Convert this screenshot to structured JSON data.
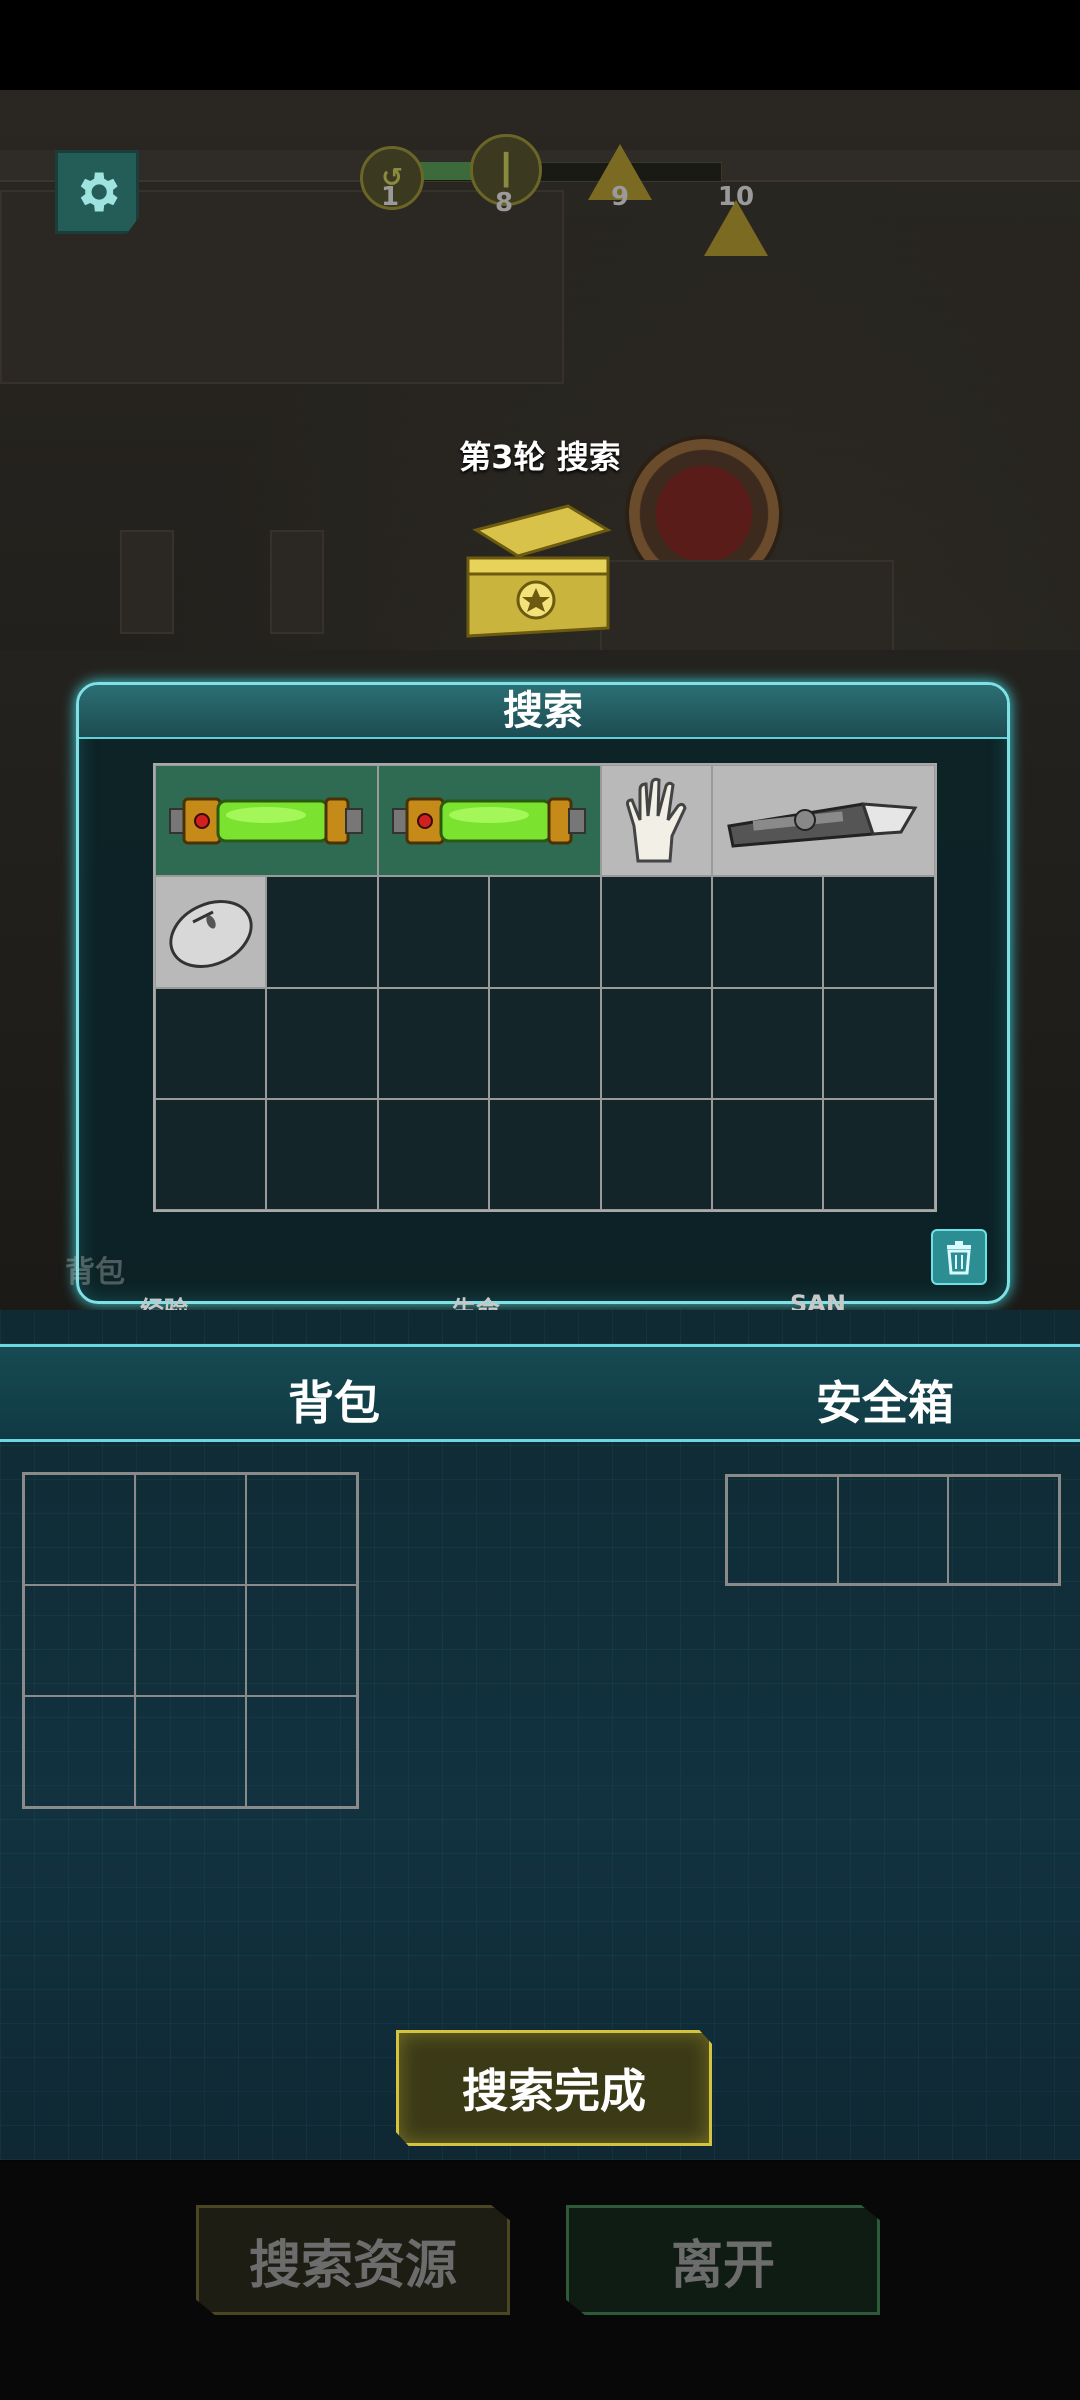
{
  "progress": {
    "nodes": [
      {
        "label": "1",
        "icon": "swirl-icon"
      },
      {
        "label": "8",
        "icon": "pin-icon"
      },
      {
        "label": "9",
        "icon": "warning-icon"
      },
      {
        "label": "10",
        "icon": "warning-icon"
      }
    ],
    "fill": 0.33
  },
  "round_title": "第3轮 搜索",
  "search_panel": {
    "title": "搜索",
    "items": [
      {
        "name": "green-canister",
        "color": "#2f6a52"
      },
      {
        "name": "green-canister",
        "color": "#2f6a52"
      },
      {
        "name": "glove",
        "color": "#b9b9b9"
      },
      {
        "name": "utility-knife",
        "color": "#b9b9b9"
      },
      {
        "name": "computer-mouse",
        "color": "#b9b9b9"
      }
    ]
  },
  "stats": {
    "exp": "经验",
    "life": "生命",
    "san": "SAN"
  },
  "bag_watermark": "背包",
  "tabs": {
    "backpack": "背包",
    "safebox": "安全箱"
  },
  "done_button": "搜索完成",
  "actions": {
    "search_resources": "搜索资源",
    "leave": "离开"
  },
  "colors": {
    "accent": "#69d8e0",
    "gold": "#d4c341",
    "green": "#2f6a52"
  }
}
